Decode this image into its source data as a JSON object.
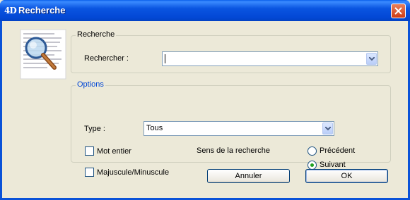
{
  "window": {
    "title": "Recherche",
    "app_icon_glyph": "4D",
    "icons": {
      "app": "4d-logo-icon",
      "close": "close-icon"
    },
    "accent_color": "#0a52d8"
  },
  "search_group": {
    "title": "Recherche",
    "label": "Rechercher :",
    "value": ""
  },
  "options_group": {
    "title": "Options",
    "type_label": "Type :",
    "type_value": "Tous",
    "whole_word": {
      "label": "Mot entier",
      "checked": false
    },
    "match_case": {
      "label": "Majuscule/Minuscule",
      "checked": false
    },
    "direction_label": "Sens de la recherche",
    "direction_options": [
      {
        "label": "Précédent",
        "selected": false
      },
      {
        "label": "Suivant",
        "selected": true
      }
    ]
  },
  "buttons": {
    "cancel": "Annuler",
    "ok": "OK"
  }
}
